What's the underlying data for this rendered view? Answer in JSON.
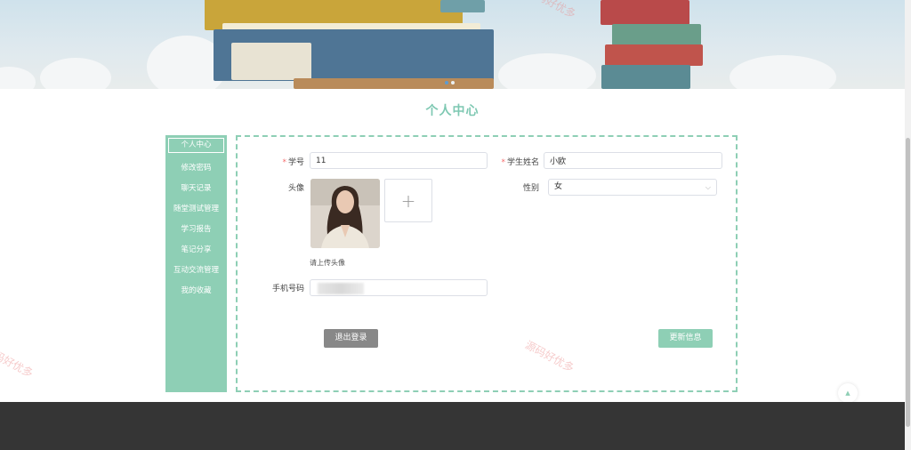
{
  "banner": {
    "slides": 2,
    "active_slide": 0
  },
  "page_title": "个人中心",
  "sidebar": {
    "items": [
      {
        "label": "个人中心",
        "active": true
      },
      {
        "label": "修改密码"
      },
      {
        "label": "聊天记录"
      },
      {
        "label": "随堂测试管理"
      },
      {
        "label": "学习报告"
      },
      {
        "label": "笔记分享"
      },
      {
        "label": "互动交流管理"
      },
      {
        "label": "我的收藏"
      }
    ]
  },
  "form": {
    "student_id": {
      "required_mark": "*",
      "label": "学号",
      "value": "11"
    },
    "student_name": {
      "required_mark": "*",
      "label": "学生姓名",
      "value": "小欧"
    },
    "avatar": {
      "label": "头像",
      "upload_icon": "+",
      "hint": "请上传头像"
    },
    "gender": {
      "label": "性别",
      "value": "女",
      "icon": "chevron-down-icon"
    },
    "phone": {
      "label": "手机号码",
      "value": ""
    }
  },
  "buttons": {
    "logout": "退出登录",
    "update": "更新信息"
  },
  "back_to_top_icon": "▲",
  "watermark": "源码好优多",
  "colors": {
    "accent": "#8ecfb5",
    "title": "#7ec8b2",
    "logout_button": "#888888",
    "footer": "#353535",
    "required": "#f56c6c"
  }
}
